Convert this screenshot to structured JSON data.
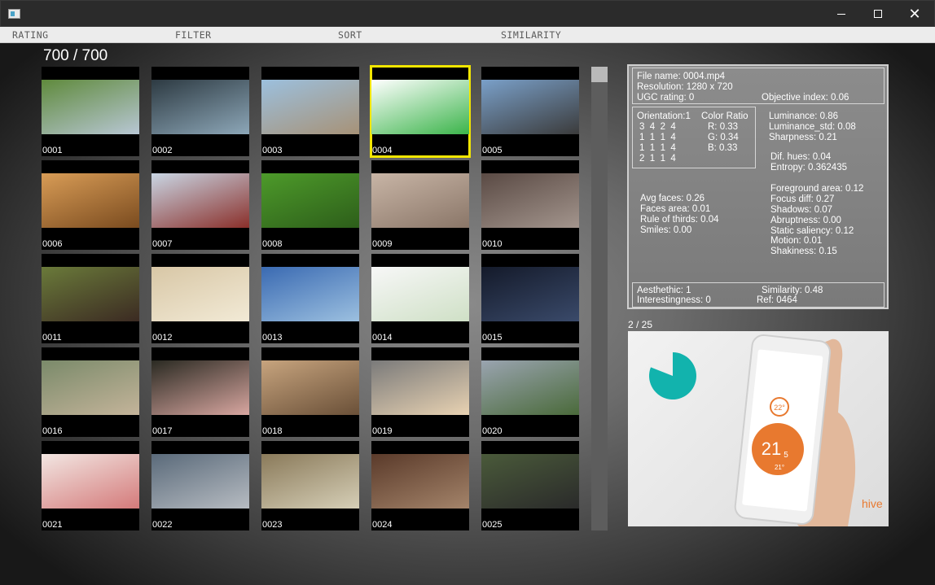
{
  "window": {
    "minimize_glyph": "",
    "close_glyph": "✕"
  },
  "menu": {
    "items": [
      "RATING",
      "FILTER",
      "SORT",
      "SIMILARITY"
    ]
  },
  "counter": "700 / 700",
  "thumbnails": [
    {
      "label": "0001",
      "colors": [
        "#5f8a3c",
        "#b8c7d4"
      ]
    },
    {
      "label": "0002",
      "colors": [
        "#2d3a42",
        "#8da7b8"
      ]
    },
    {
      "label": "0003",
      "colors": [
        "#9cc0de",
        "#a79277"
      ]
    },
    {
      "label": "0004",
      "colors": [
        "#ffffff",
        "#3bb44a"
      ]
    },
    {
      "label": "0005",
      "colors": [
        "#7aa0c9",
        "#3b3b3b"
      ]
    },
    {
      "label": "0006",
      "colors": [
        "#d89c56",
        "#7a4b1f"
      ]
    },
    {
      "label": "0007",
      "colors": [
        "#c9d6e4",
        "#8a2f2a"
      ]
    },
    {
      "label": "0008",
      "colors": [
        "#4d9a2a",
        "#2d5e1a"
      ]
    },
    {
      "label": "0009",
      "colors": [
        "#c8b5a6",
        "#8a7668"
      ]
    },
    {
      "label": "0010",
      "colors": [
        "#5a4a44",
        "#a3958d"
      ]
    },
    {
      "label": "0011",
      "colors": [
        "#6a7a3a",
        "#3b2a22"
      ]
    },
    {
      "label": "0012",
      "colors": [
        "#d8c7a6",
        "#f2ead6"
      ]
    },
    {
      "label": "0013",
      "colors": [
        "#3a6ab2",
        "#9cc0e0"
      ]
    },
    {
      "label": "0014",
      "colors": [
        "#f7f7f7",
        "#cfe0c6"
      ]
    },
    {
      "label": "0015",
      "colors": [
        "#141a2a",
        "#3a4a6a"
      ]
    },
    {
      "label": "0016",
      "colors": [
        "#7a8a6a",
        "#c4b49a"
      ]
    },
    {
      "label": "0017",
      "colors": [
        "#2a2a22",
        "#d8a6a0"
      ]
    },
    {
      "label": "0018",
      "colors": [
        "#c7a47e",
        "#6a5038"
      ]
    },
    {
      "label": "0019",
      "colors": [
        "#7a7a7a",
        "#e8d2b2"
      ]
    },
    {
      "label": "0020",
      "colors": [
        "#9aa4b0",
        "#4a6a3a"
      ]
    },
    {
      "label": "0021",
      "colors": [
        "#f2e6e2",
        "#d47a7a"
      ]
    },
    {
      "label": "0022",
      "colors": [
        "#5a6a7a",
        "#b7bcc2"
      ]
    },
    {
      "label": "0023",
      "colors": [
        "#8a7a5a",
        "#d6cfb7"
      ]
    },
    {
      "label": "0024",
      "colors": [
        "#5a3a2a",
        "#a4846a"
      ]
    },
    {
      "label": "0025",
      "colors": [
        "#4a5a3a",
        "#2a2a2a"
      ]
    }
  ],
  "selected_index": 3,
  "colors": {
    "selection": "#f2e600",
    "panel_border": "#cfcfcf"
  },
  "info": {
    "file_name": "File name: 0004.mp4",
    "resolution": "Resolution: 1280 x 720",
    "ugc_rating": "UGC rating: 0",
    "objective_index": "Objective index: 0.06",
    "orientation": "Orientation:1",
    "orientation_rows": [
      "3  4  2  4",
      "1  1  1  4",
      "1  1  1  4",
      "2  1  1  4"
    ],
    "color_ratio": "Color Ratio",
    "color_r": "R: 0.33",
    "color_g": "G: 0.34",
    "color_b": "B: 0.33",
    "luminance": "Luminance: 0.86",
    "luminance_std": "Luminance_std: 0.08",
    "sharpness": "Sharpness: 0.21",
    "dif_hues": "Dif. hues: 0.04",
    "entropy": "Entropy: 0.362435",
    "avg_faces": "Avg faces: 0.26",
    "faces_area": "Faces area: 0.01",
    "rule_of_thirds": "Rule of thirds: 0.04",
    "smiles": "Smiles: 0.00",
    "foreground_area": "Foreground area: 0.12",
    "focus_diff": "Focus diff: 0.27",
    "shadows": "Shadows: 0.07",
    "abruptness": "Abruptness: 0.00",
    "static_saliency": "Static saliency: 0.12",
    "motion": "Motion: 0.01",
    "shakiness": "Shakiness: 0.15",
    "aesthetic": "Aesthethic: 1",
    "similarity": "Similarity: 0.48",
    "interestingness": "Interestingness: 0",
    "ref": "Ref: 0464"
  },
  "preview": {
    "counter": "2 / 25",
    "phone_temp_big": "21",
    "phone_temp_sub": "5",
    "phone_temp_deg": "°",
    "phone_temp_top": "22°",
    "phone_temp_bottom": "21°",
    "brand": "hive",
    "accent": "#e8792f",
    "pie_color": "#12b3ad",
    "pie_fraction": 0.81
  }
}
